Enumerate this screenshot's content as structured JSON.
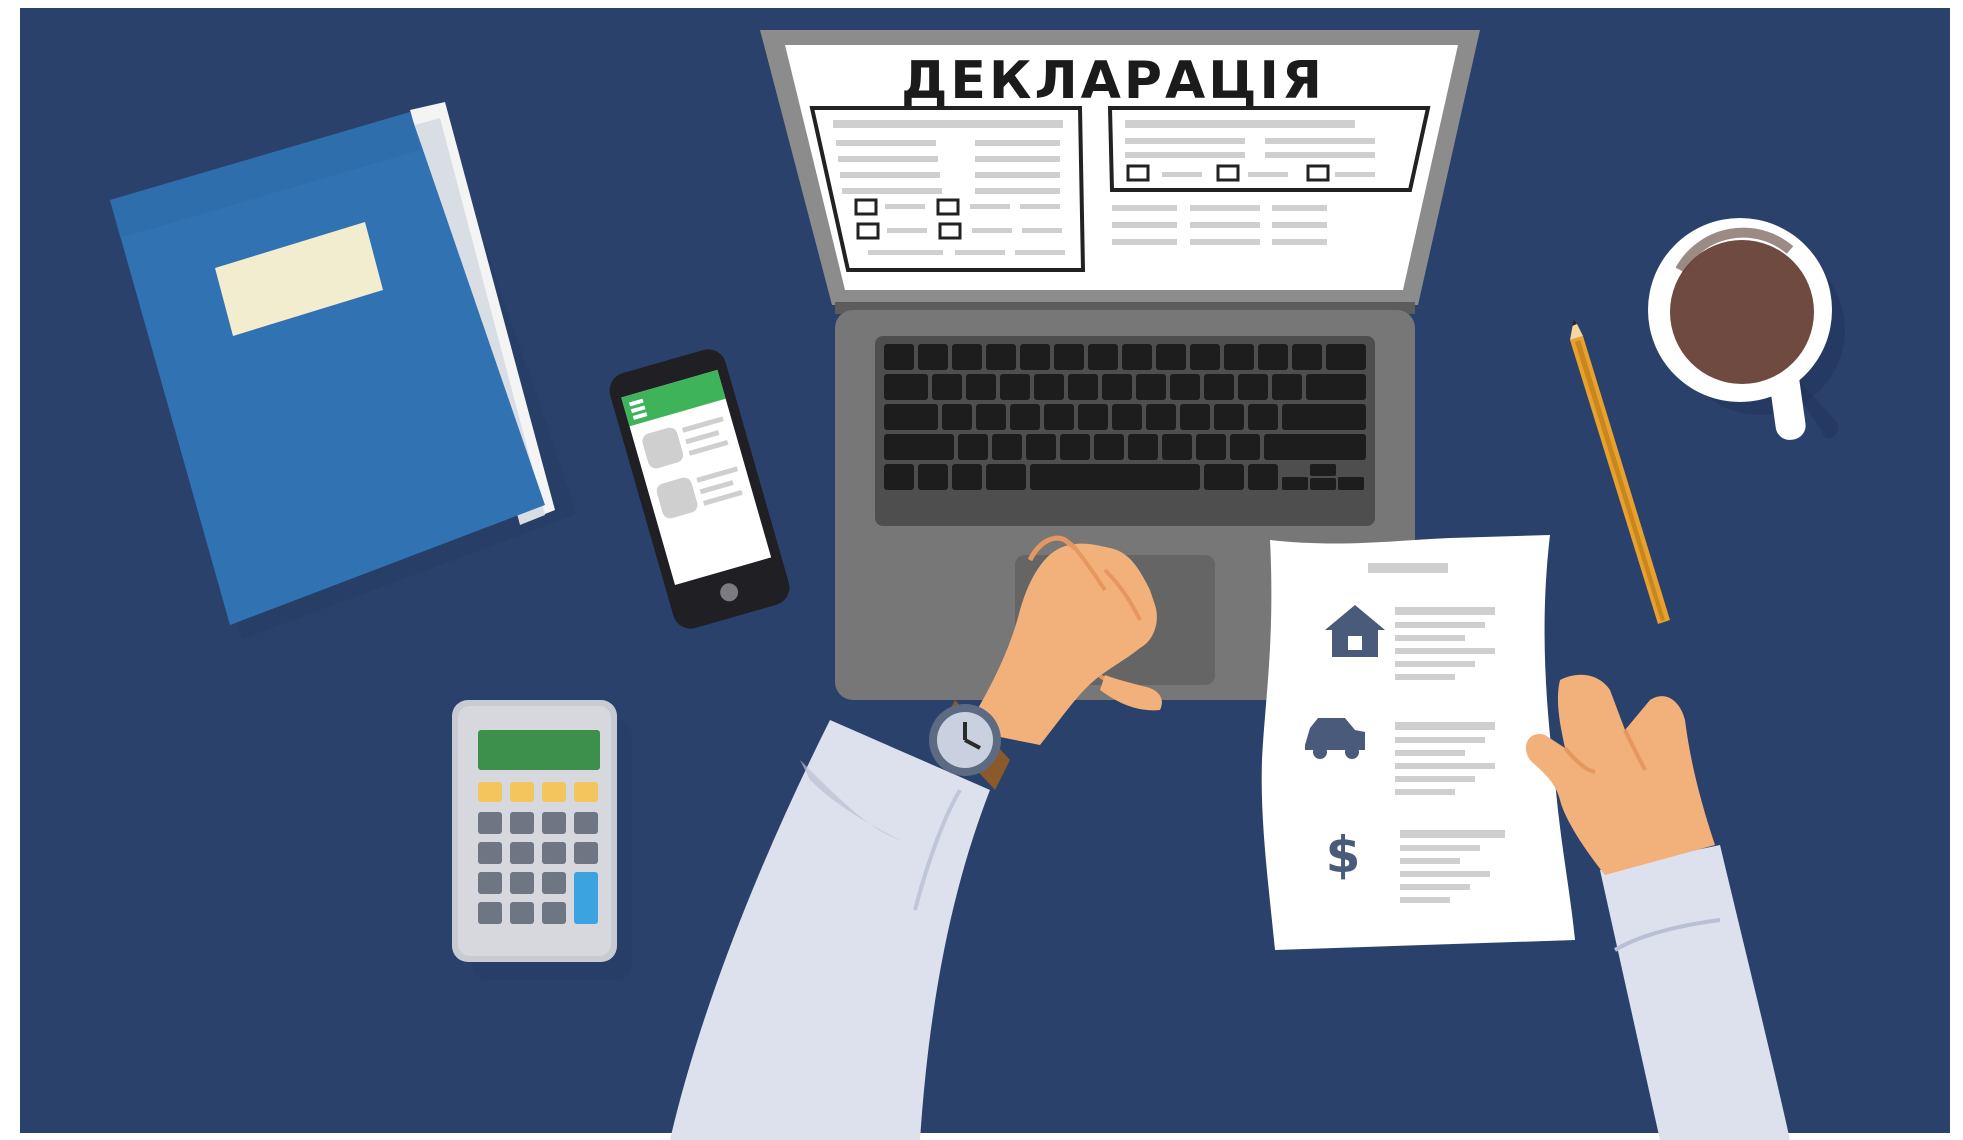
{
  "illustration": {
    "screen_title": "ДЕКЛАРАЦІЯ",
    "dollar_sign": "$"
  },
  "colors": {
    "desk": "#2a416b",
    "folder": "#3172b2",
    "laptop_body": "#777777",
    "keyboard": "#1d1d1d",
    "skin": "#f2b07b",
    "sleeve": "#dde1ee",
    "phone_accent": "#3fb35a",
    "calculator_display": "#3d8f4c",
    "calculator_keys_yellow": "#f2c65c",
    "calculator_key_blue": "#3aa3e0",
    "coffee": "#6e4a40",
    "pencil": "#e7a12c",
    "icons": "#4a5a7a"
  },
  "icons": [
    "house-icon",
    "car-icon",
    "dollar-icon",
    "clock-icon"
  ]
}
